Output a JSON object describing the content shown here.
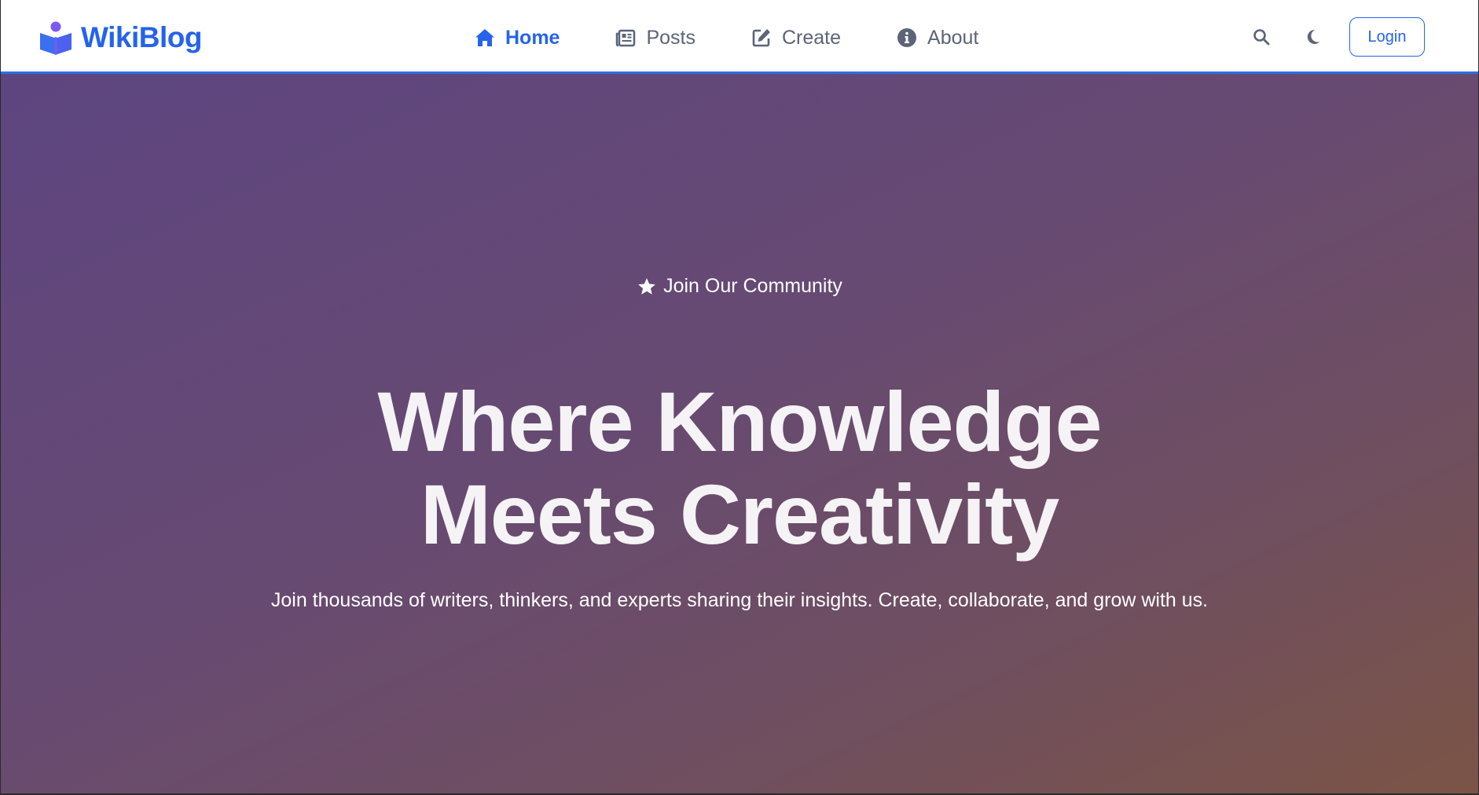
{
  "navbar": {
    "brand": "WikiBlog",
    "brand_icon": "reader-book-icon",
    "links": [
      {
        "label": "Home",
        "icon": "home-icon",
        "active": true
      },
      {
        "label": "Posts",
        "icon": "newspaper-icon",
        "active": false
      },
      {
        "label": "Create",
        "icon": "edit-icon",
        "active": false
      },
      {
        "label": "About",
        "icon": "info-circle-icon",
        "active": false
      }
    ],
    "search_icon": "search-icon",
    "theme_icon": "moon-icon",
    "login_label": "Login"
  },
  "hero": {
    "badge": "Join Our Community",
    "badge_icon": "star-icon",
    "title_line1": "Where Knowledge",
    "title_line2": "Meets Creativity",
    "subtitle": "Join thousands of writers, thinkers, and experts sharing their insights. Create, collaborate, and grow with us."
  },
  "colors": {
    "accent": "#2563eb",
    "nav_text": "#5b6478",
    "hero_gradient_start": "#5d4580",
    "hero_gradient_end": "#7b5446",
    "brand_icon_purple": "#7c5cf0"
  }
}
